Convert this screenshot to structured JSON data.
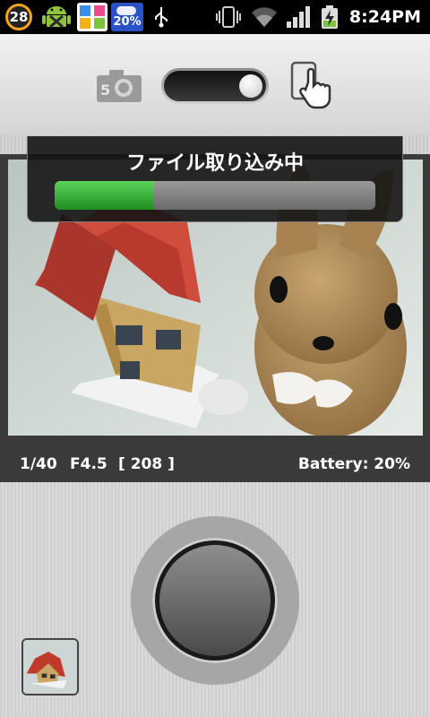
{
  "status_bar": {
    "badge_number": "28",
    "weather_temp": "20%",
    "time": "8:24PM",
    "icons": [
      "badge-icon",
      "android-icon",
      "photo-gallery-icon",
      "weather-icon",
      "usb-icon",
      "vibrate-icon",
      "wifi-icon",
      "signal-icon",
      "battery-charging-icon"
    ]
  },
  "top_controls": {
    "camera_mode_icon": "camera-icon",
    "switch_state": "right",
    "touch_mode_icon": "touch-shutter-icon"
  },
  "progress": {
    "text": "ファイル取り込み中",
    "value": 0.31,
    "color": "#2fb02f"
  },
  "info": {
    "shutter": "1/40",
    "aperture": "F4.5",
    "shots_remaining": "[ 208 ]",
    "battery": "Battery: 20%"
  },
  "bottom": {
    "shutter_icon": "shutter-button",
    "thumbnail_icon": "last-photo-thumbnail"
  }
}
